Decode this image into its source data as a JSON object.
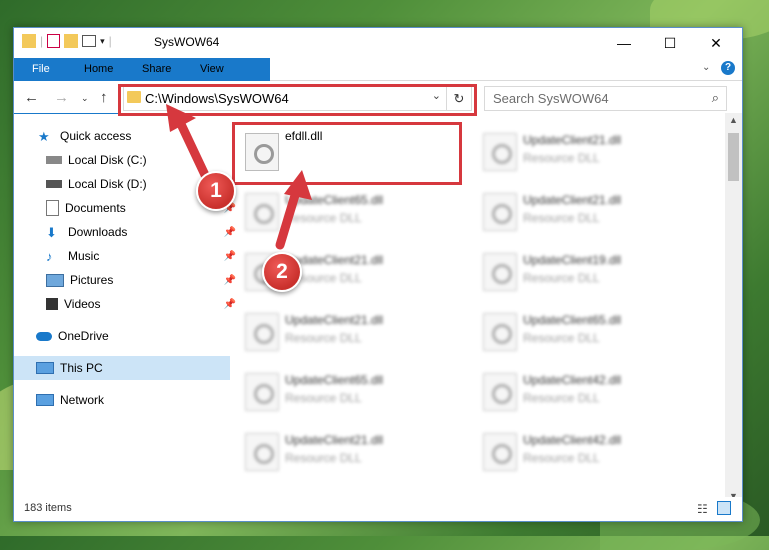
{
  "window": {
    "title": "SysWOW64"
  },
  "ribbon": {
    "tabs": [
      "File",
      "Home",
      "Share",
      "View"
    ]
  },
  "address": {
    "path": "C:\\Windows\\SysWOW64"
  },
  "search": {
    "placeholder": "Search SysWOW64"
  },
  "nav": {
    "items": [
      {
        "label": "Quick access",
        "icon": "star-icon"
      },
      {
        "label": "Local Disk (C:)",
        "icon": "drive-icon"
      },
      {
        "label": "Local Disk (D:)",
        "icon": "drive-icon"
      },
      {
        "label": "Documents",
        "icon": "document-icon",
        "pinned": true
      },
      {
        "label": "Downloads",
        "icon": "download-icon",
        "pinned": true
      },
      {
        "label": "Music",
        "icon": "music-icon",
        "pinned": true
      },
      {
        "label": "Pictures",
        "icon": "picture-icon",
        "pinned": true
      },
      {
        "label": "Videos",
        "icon": "video-icon",
        "pinned": true
      },
      {
        "label": "OneDrive",
        "icon": "cloud-icon"
      },
      {
        "label": "This PC",
        "icon": "computer-icon",
        "selected": true
      },
      {
        "label": "Network",
        "icon": "network-icon"
      }
    ]
  },
  "files": {
    "highlighted": {
      "name": "efdll.dll"
    },
    "col1": [
      {
        "name": "UpdateClient65.dll",
        "type": "Resource DLL"
      },
      {
        "name": "UpdateClient21.dll",
        "type": "Resource DLL"
      },
      {
        "name": "UpdateClient21.dll",
        "type": "Resource DLL"
      },
      {
        "name": "UpdateClient65.dll",
        "type": "Resource DLL"
      },
      {
        "name": "UpdateClient21.dll",
        "type": "Resource DLL"
      }
    ],
    "col2": [
      {
        "name": "UpdateClient21.dll",
        "type": "Resource DLL"
      },
      {
        "name": "UpdateClient21.dll",
        "type": "Resource DLL"
      },
      {
        "name": "UpdateClient19.dll",
        "type": "Resource DLL"
      },
      {
        "name": "UpdateClient65.dll",
        "type": "Resource DLL"
      },
      {
        "name": "UpdateClient42.dll",
        "type": "Resource DLL"
      },
      {
        "name": "UpdateClient42.dll",
        "type": "Resource DLL"
      }
    ]
  },
  "status": {
    "count": "183 items"
  },
  "annotations": {
    "step1": "1",
    "step2": "2",
    "color": "#d6383e"
  }
}
